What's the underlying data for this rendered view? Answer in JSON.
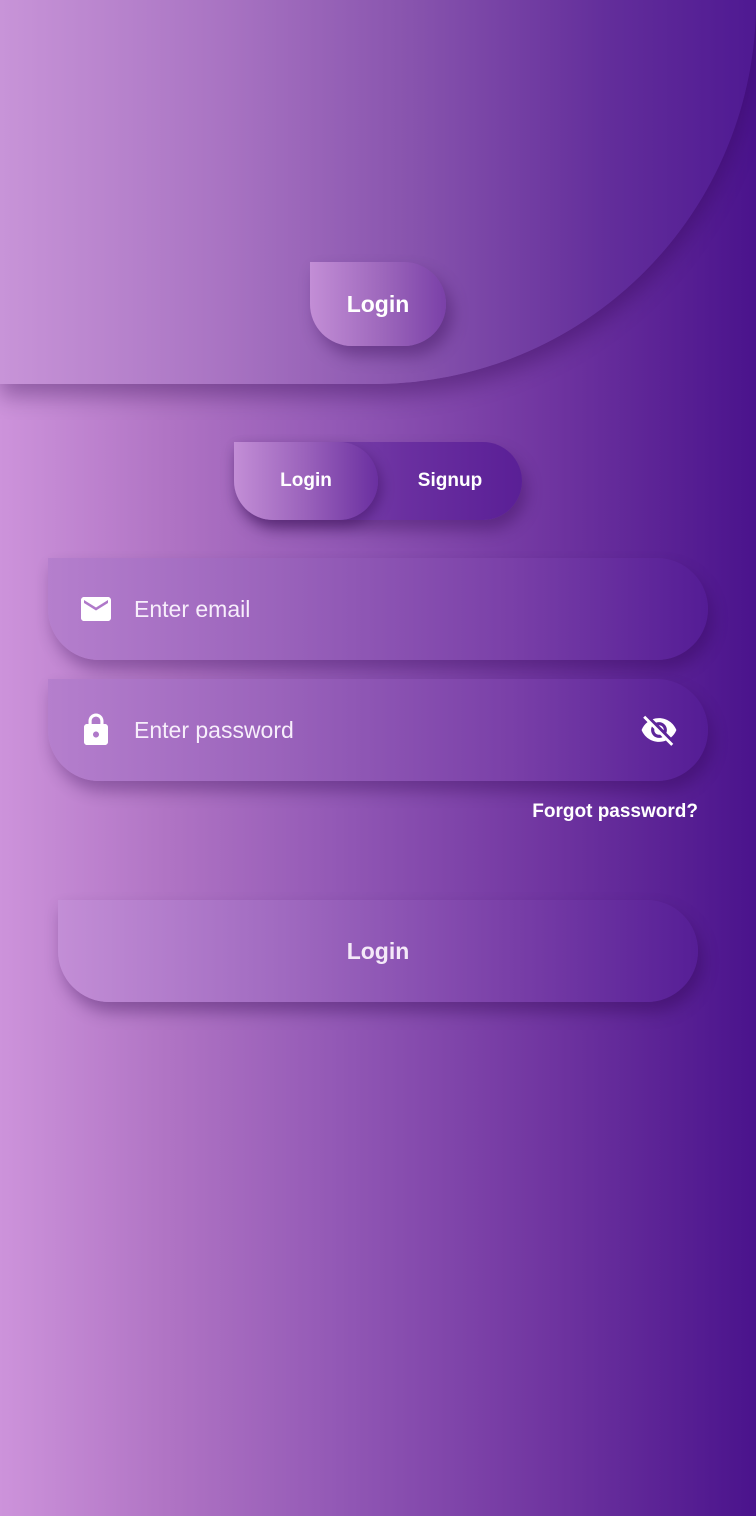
{
  "header": {
    "login_label": "Login"
  },
  "toggle": {
    "login_label": "Login",
    "signup_label": "Signup",
    "active": "Login"
  },
  "email": {
    "icon": "mail-icon",
    "placeholder": "Enter email",
    "value": ""
  },
  "password": {
    "icon": "lock-icon",
    "placeholder": "Enter password",
    "value": "",
    "visibility_icon": "eye-off-icon"
  },
  "forgot_password_label": "Forgot password?",
  "submit": {
    "label": "Login"
  },
  "colors": {
    "gradient_start": "#cd93db",
    "gradient_end": "#4a138c",
    "text": "#ffffff"
  }
}
